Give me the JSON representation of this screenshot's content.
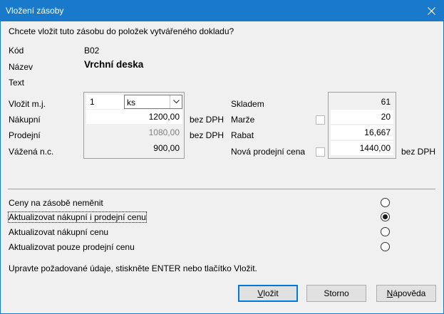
{
  "window": {
    "title": "Vložení zásoby",
    "prompt": "Chcete vložit tuto zásobu do položek vytvářeného dokladu?"
  },
  "info": {
    "kod_label": "Kód",
    "kod_value": "B02",
    "nazev_label": "Název",
    "nazev_value": "Vrchní deska",
    "text_label": "Text"
  },
  "left": {
    "vlozit_label": "Vložit m.j.",
    "qty_value": "1",
    "unit_value": "ks",
    "nakupni_label": "Nákupní",
    "nakupni_value": "1200,00",
    "prodejni_label": "Prodejní",
    "prodejni_value": "1080,00",
    "vazena_label": "Vážená n.c.",
    "vazena_value": "900,00",
    "bez_dph_1": "bez DPH",
    "bez_dph_2": "bez DPH"
  },
  "right": {
    "skladem_label": "Skladem",
    "skladem_value": "61",
    "marze_label": "Marže",
    "marze_value": "20",
    "rabat_label": "Rabat",
    "rabat_value": "16,667",
    "nova_label": "Nová prodejní cena",
    "nova_value": "1440,00",
    "bez_dph_3": "bez DPH"
  },
  "options": [
    {
      "label": "Ceny na zásobě neměnit",
      "selected": false
    },
    {
      "label": "Aktualizovat nákupní i prodejní cenu",
      "selected": true
    },
    {
      "label": "Aktualizovat nákupní cenu",
      "selected": false
    },
    {
      "label": "Aktualizovat pouze prodejní cenu",
      "selected": false
    }
  ],
  "footer": {
    "hint": "Upravte požadované údaje, stiskněte ENTER nebo tlačítko Vložit.",
    "vlozit_mnemonic": "V",
    "vlozit_rest": "ložit",
    "storno": "Storno",
    "napoveda_mnemonic": "N",
    "napoveda_rest": "ápověda"
  }
}
